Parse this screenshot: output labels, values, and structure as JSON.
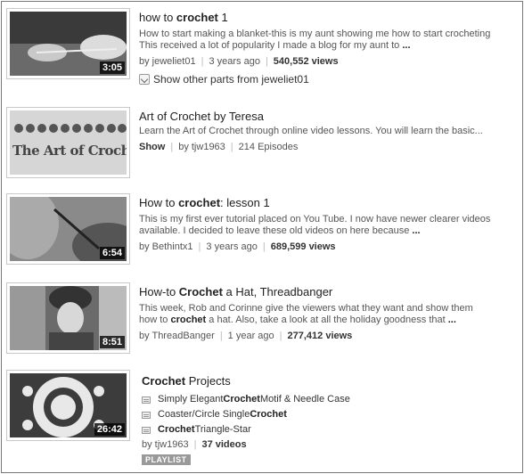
{
  "results": [
    {
      "title_pre": "how to ",
      "title_bold": "crochet",
      "title_post": " 1",
      "desc_line1": "How to start making a blanket-this is my aunt showing me how to start crocheting",
      "desc_line2": "This received a lot of popularity I made a blog for my aunt to",
      "ellipsis": "...",
      "author": "by jeweliet01",
      "age": "3 years ago",
      "views": "540,552 views",
      "duration": "3:05",
      "more_parts": "Show other parts from jeweliet01"
    },
    {
      "title": "Art of Crochet by Teresa",
      "desc_line1": "Learn the Art of Crochet through online video lessons. You will learn the basic...",
      "show_label": "Show",
      "author": "by tjw1963",
      "episodes": "214 Episodes",
      "thumb_text": "The Art of Crochet"
    },
    {
      "title_pre": "How to ",
      "title_bold": "crochet",
      "title_post": ": lesson 1",
      "desc_line1": "This is my first ever tutorial placed on You Tube. I now have newer clearer videos",
      "desc_line2": "available. I decided to leave these old videos on here because",
      "ellipsis": "...",
      "author": "by Bethintx1",
      "age": "3 years ago",
      "views": "689,599 views",
      "duration": "6:54"
    },
    {
      "title_pre": "How-to ",
      "title_bold": "Crochet",
      "title_post": " a Hat, Threadbanger",
      "desc_line1": "This week, Rob and Corinne give the viewers what they want and show them",
      "desc_line2_pre": "how to ",
      "desc_line2_bold": "crochet",
      "desc_line2_post": " a hat. Also, take a look at all the holiday goodness that",
      "ellipsis": "...",
      "author": "by ThreadBanger",
      "age": "1 year ago",
      "views": "277,412 views",
      "duration": "8:51"
    },
    {
      "title_bold": "Crochet",
      "title_post": " Projects",
      "items": [
        {
          "pre": "Simply Elegant ",
          "bold": "Crochet",
          "post": " Motif & Needle Case"
        },
        {
          "pre": "Coaster/Circle Single ",
          "bold": "Crochet",
          "post": ""
        },
        {
          "pre": "",
          "bold": "Crochet",
          "post": " Triangle-Star"
        }
      ],
      "author": "by tjw1963",
      "count": "37 videos",
      "badge": "PLAYLIST",
      "duration": "26:42"
    }
  ]
}
